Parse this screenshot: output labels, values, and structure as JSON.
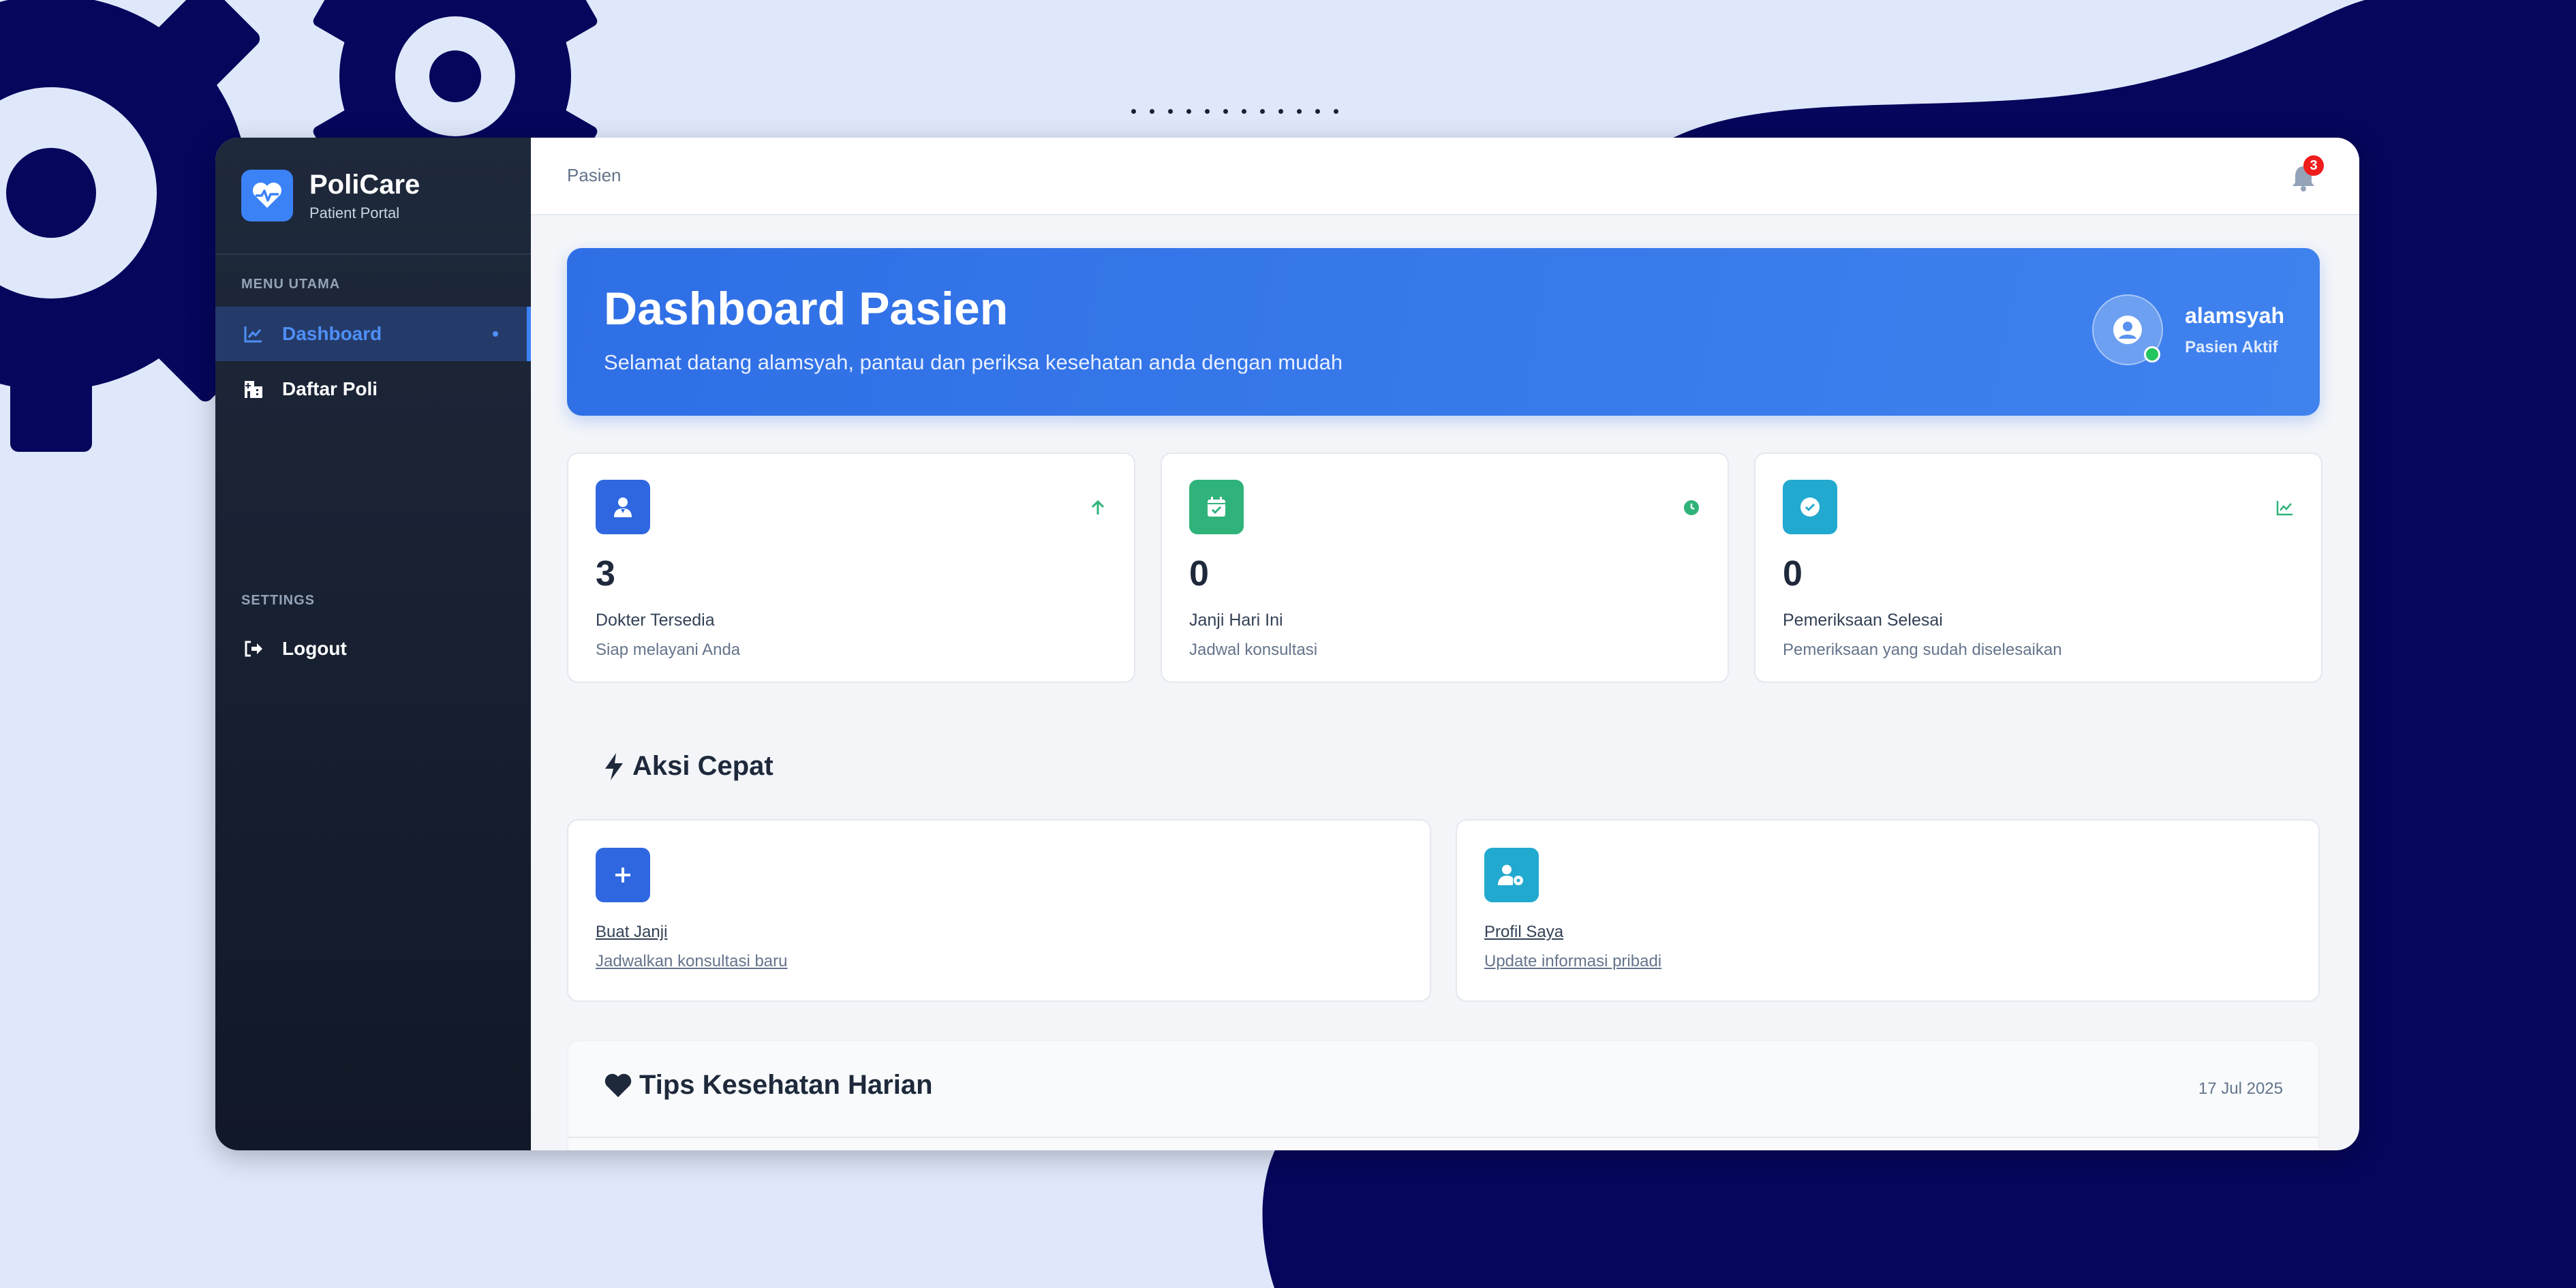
{
  "brand": {
    "name": "PoliCare",
    "subtitle": "Patient Portal",
    "logo_icon": "heart-pulse-icon"
  },
  "sidebar": {
    "sections": [
      {
        "title": "MENU UTAMA",
        "items": [
          {
            "label": "Dashboard",
            "icon": "chart-line-icon",
            "active": true
          },
          {
            "label": "Daftar Poli",
            "icon": "hospital-icon",
            "active": false
          }
        ]
      },
      {
        "title": "SETTINGS",
        "items": [
          {
            "label": "Logout",
            "icon": "logout-icon",
            "active": false
          }
        ]
      }
    ]
  },
  "topbar": {
    "breadcrumb": "Pasien",
    "notification_count": "3"
  },
  "hero": {
    "title": "Dashboard Pasien",
    "subtitle": "Selamat datang alamsyah, pantau dan periksa kesehatan anda dengan mudah",
    "user_name": "alamsyah",
    "user_status": "Pasien Aktif"
  },
  "stats": [
    {
      "value": "3",
      "label": "Dokter Tersedia",
      "description": "Siap melayani Anda",
      "icon": "doctor-icon",
      "trend_icon": "arrow-up-icon",
      "color": "#2f67e0"
    },
    {
      "value": "0",
      "label": "Janji Hari Ini",
      "description": "Jadwal konsultasi",
      "icon": "calendar-check-icon",
      "trend_icon": "clock-icon",
      "color": "#2fb37a"
    },
    {
      "value": "0",
      "label": "Pemeriksaan Selesai",
      "description": "Pemeriksaan yang sudah diselesaikan",
      "icon": "check-circle-icon",
      "trend_icon": "chart-line-icon",
      "color": "#22a9cf"
    }
  ],
  "quick_actions": {
    "title": "Aksi Cepat",
    "items": [
      {
        "title": "Buat Janji",
        "description": "Jadwalkan konsultasi baru",
        "icon": "plus-icon",
        "color": "#2f67e0"
      },
      {
        "title": "Profil Saya",
        "description": "Update informasi pribadi",
        "icon": "user-gear-icon",
        "color": "#22a9cf"
      }
    ]
  },
  "tips": {
    "title": "Tips Kesehatan Harian",
    "date": "17 Jul 2025"
  },
  "colors": {
    "background": "#dfe8fb",
    "navy": "#06065c",
    "accent": "#3b82f6",
    "success": "#22c55e",
    "danger": "#ef1c1c"
  }
}
